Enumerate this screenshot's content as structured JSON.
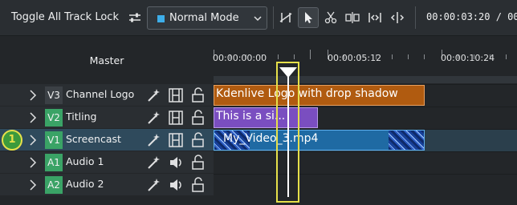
{
  "toolbar": {
    "toggle_lock_label": "Toggle All Track Lock",
    "mode_icon": "settings-sliders-icon",
    "mode_select_value": "Normal Mode",
    "tools": [
      "spacer-tool-icon",
      "select-tool-icon",
      "razor-tool-icon",
      "ripple-tool-icon",
      "slip-tool-icon",
      "multicam-tool-icon"
    ],
    "timecode": "00:00:03:20 / 00"
  },
  "header": {
    "master_label": "Master",
    "ruler_labels": [
      "00:00:00:00",
      "00:00:05:12",
      "00:00:10:24"
    ]
  },
  "tracks": [
    {
      "id": "V3",
      "name": "Channel Logo",
      "color": "#3b4045"
    },
    {
      "id": "V2",
      "name": "Titling",
      "color": "#3aa366"
    },
    {
      "id": "V1",
      "name": "Screencast",
      "color": "#3aa366"
    },
    {
      "id": "A1",
      "name": "Audio 1",
      "color": "#3aa366"
    },
    {
      "id": "A2",
      "name": "Audio 2",
      "color": "#3aa366"
    }
  ],
  "clips": {
    "logo": "Kdenlive Logo with drop shadow",
    "titling": "This is a si...",
    "video": "My_Video_3.mp4"
  },
  "marker": "1",
  "colors": {
    "accent": "#3daee9",
    "highlight": "#e6e04a",
    "logo_clip": "#b05b10",
    "title_clip": "#7a4ec0",
    "video_clip": "#1f6aa3"
  }
}
